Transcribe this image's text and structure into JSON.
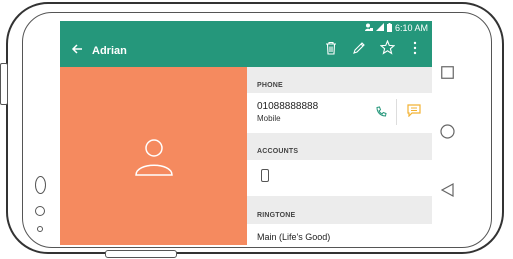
{
  "status_bar": {
    "time": "6:10 AM"
  },
  "toolbar": {
    "title": "Adrian"
  },
  "sections": {
    "phone_header": "PHONE",
    "accounts_header": "ACCOUNTS",
    "ringtone_header": "RINGTONE"
  },
  "phone_entry": {
    "number": "01088888888",
    "type": "Mobile"
  },
  "ringtone": {
    "value": "Main (Life's Good)"
  },
  "colors": {
    "app_bar": "#25977b",
    "avatar_bg": "#f58a5f",
    "call_icon": "#25977b",
    "message_icon": "#f2b233"
  },
  "icons": [
    "back-arrow-icon",
    "delete-icon",
    "edit-icon",
    "star-icon",
    "more-icon",
    "person-icon",
    "call-icon",
    "message-icon",
    "device-account-icon",
    "recent-apps-icon",
    "home-icon",
    "back-nav-icon"
  ]
}
